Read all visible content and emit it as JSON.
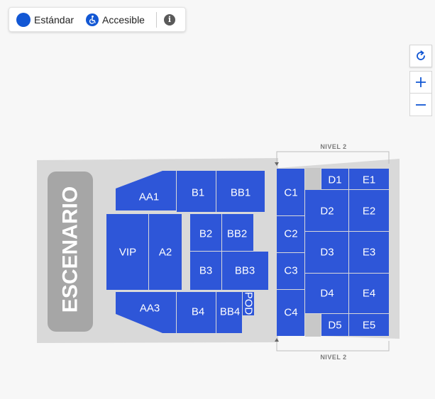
{
  "legend": {
    "standard_label": "Estándar",
    "accessible_label": "Accesible",
    "info_symbol": "i",
    "standard_color": "#1257d4"
  },
  "controls": {
    "reset_icon": "refresh-icon",
    "zoom_in_symbol": "+",
    "zoom_out_symbol": "−"
  },
  "map": {
    "stage_label": "ESCENARIO",
    "level_label_top": "NIVEL 2",
    "level_label_bottom": "NIVEL 2",
    "section_color": "#2e56d8",
    "floor_color": "#d9d9d9",
    "stage_color": "#a6a6a6",
    "sections": {
      "AA1": "AA1",
      "B1": "B1",
      "BB1": "BB1",
      "VIP": "VIP",
      "A2": "A2",
      "B2": "B2",
      "BB2": "BB2",
      "B3": "B3",
      "BB3": "BB3",
      "AA3": "AA3",
      "B4": "B4",
      "BB4": "BB4",
      "POD": "POD",
      "C1": "C1",
      "C2": "C2",
      "C3": "C3",
      "C4": "C4",
      "D1": "D1",
      "D2": "D2",
      "D3": "D3",
      "D4": "D4",
      "D5": "D5",
      "E1": "E1",
      "E2": "E2",
      "E3": "E3",
      "E4": "E4",
      "E5": "E5"
    }
  }
}
